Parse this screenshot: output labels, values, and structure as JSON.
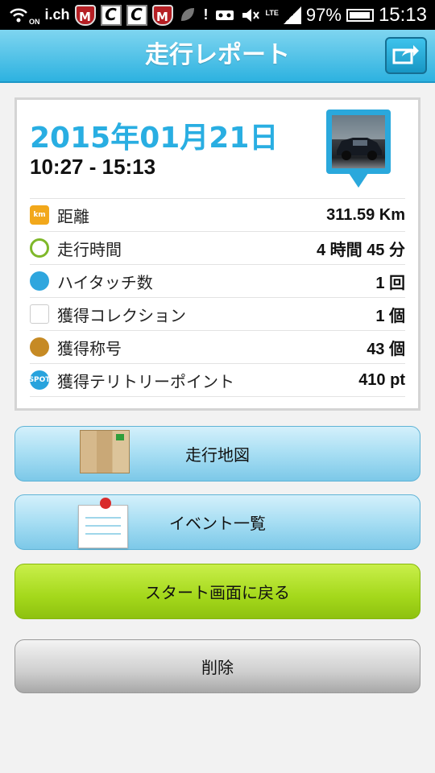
{
  "status_bar": {
    "brand": "i.ch",
    "on_label": "ON",
    "battery_percent": "97%",
    "time": "15:13",
    "network": "LTE",
    "icons": [
      "wifi-icon",
      "mcafee-icon",
      "c-icon",
      "c-icon",
      "mcafee-icon",
      "leaf-icon",
      "alert-icon",
      "voicemail-icon",
      "mute-icon",
      "signal-icon",
      "battery-icon"
    ]
  },
  "header": {
    "title": "走行レポート",
    "share_icon": "share-icon"
  },
  "report": {
    "date": "2015年01月21日",
    "time_range": "10:27 - 15:13",
    "thumbnail_icon": "car-photo-thumbnail",
    "stats": [
      {
        "icon": "km-icon",
        "icon_text": "km",
        "label": "距離",
        "value": "311.59 Km",
        "color": "#f2a81b"
      },
      {
        "icon": "clock-icon",
        "icon_text": "",
        "label": "走行時間",
        "value": "4 時間 45 分",
        "color": "#7fb82a"
      },
      {
        "icon": "hand-icon",
        "icon_text": "",
        "label": "ハイタッチ数",
        "value": "1 回",
        "color": "#2fa6de"
      },
      {
        "icon": "car-icon",
        "icon_text": "",
        "label": "獲得コレクション",
        "value": "1 個",
        "color": "#d93a3a"
      },
      {
        "icon": "medal-icon",
        "icon_text": "",
        "label": "獲得称号",
        "value": "43 個",
        "color": "#c68a24"
      },
      {
        "icon": "spot-icon",
        "icon_text": "SPOT",
        "label": "獲得テリトリーポイント",
        "value": "410 pt",
        "color": "#28a3dd"
      }
    ]
  },
  "buttons": {
    "map": "走行地図",
    "events": "イベント一覧",
    "back_to_start": "スタート画面に戻る",
    "delete": "削除"
  }
}
